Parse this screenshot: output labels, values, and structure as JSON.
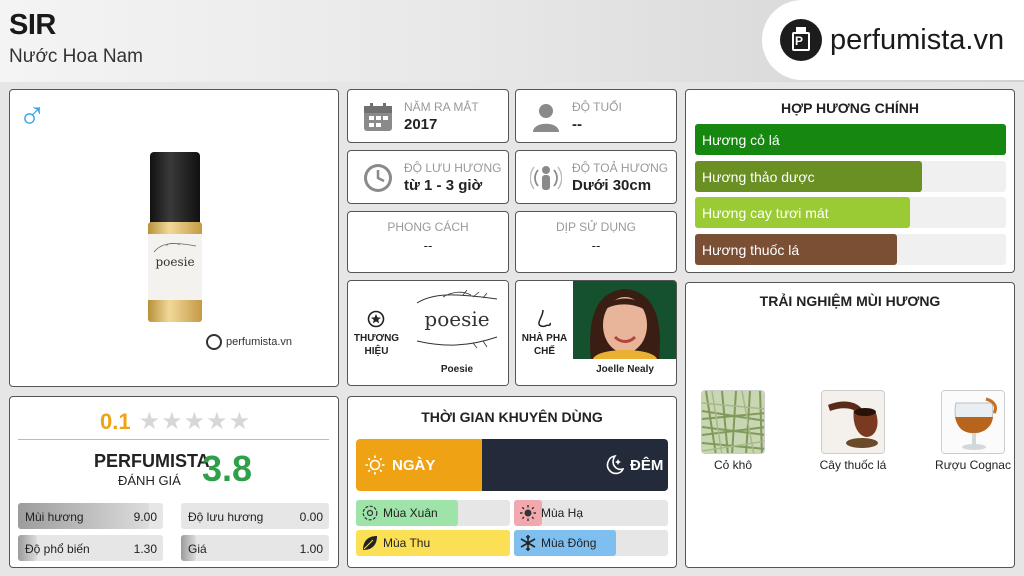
{
  "header": {
    "title": "SIR",
    "subtitle": "Nước Hoa Nam",
    "logo_text": "perfumista.vn"
  },
  "product": {
    "gender_symbol": "♂",
    "label_text": "poesie",
    "watermark": "perfumista.vn"
  },
  "rating": {
    "user_score": "0.1",
    "user_stars": 0,
    "perfumista_label": "PERFUMISTA",
    "perfumista_sub": "ĐÁNH GIÁ",
    "perfumista_score": "3.8",
    "stats": [
      {
        "label": "Mùi hương",
        "value": "9.00",
        "fraction": 0.9
      },
      {
        "label": "Độ lưu hương",
        "value": "0.00",
        "fraction": 0.0
      },
      {
        "label": "Độ phổ biến",
        "value": "1.30",
        "fraction": 0.13
      },
      {
        "label": "Giá",
        "value": "1.00",
        "fraction": 0.1
      }
    ]
  },
  "info": {
    "year": {
      "label": "NĂM RA MẮT",
      "value": "2017"
    },
    "age": {
      "label": "ĐỘ TUỔI",
      "value": "--"
    },
    "longevity": {
      "label": "ĐỘ LƯU HƯƠNG",
      "value": "từ 1 - 3 giờ"
    },
    "sillage": {
      "label": "ĐỘ TOẢ HƯƠNG",
      "value": "Dưới 30cm"
    },
    "style": {
      "label": "PHONG CÁCH",
      "value": "--"
    },
    "occasion": {
      "label": "DỊP SỬ DỤNG",
      "value": "--"
    },
    "brand": {
      "label": "THƯƠNG HIỆU",
      "logo_text": "poesie",
      "name": "Poesie"
    },
    "perfumer": {
      "label": "NHÀ PHA CHẾ",
      "name": "Joelle Nealy"
    }
  },
  "time": {
    "title": "THỜI GIAN KHUYÊN DÙNG",
    "day_label": "NGÀY",
    "night_label": "ĐÊM",
    "seasons": [
      {
        "label": "Mùa Xuân",
        "fraction": 0.66,
        "color": "#9ee3a8"
      },
      {
        "label": "Mùa Hạ",
        "fraction": 0.18,
        "color": "#f2a9ad"
      },
      {
        "label": "Mùa Thu",
        "fraction": 1.0,
        "color": "#fbdf55"
      },
      {
        "label": "Mùa Đông",
        "fraction": 0.66,
        "color": "#7fbfef"
      }
    ]
  },
  "accords": {
    "title": "HỢP HƯƠNG CHÍNH",
    "items": [
      {
        "label": "Hương cỏ lá",
        "fraction": 1.0,
        "color": "#16870f"
      },
      {
        "label": "Hương thảo dược",
        "fraction": 0.73,
        "color": "#6a8f23"
      },
      {
        "label": "Hương cay tươi mát",
        "fraction": 0.69,
        "color": "#9acb35"
      },
      {
        "label": "Hương thuốc lá",
        "fraction": 0.65,
        "color": "#7b4f33"
      }
    ]
  },
  "notes": {
    "title": "TRẢI NGHIỆM MÙI HƯƠNG",
    "items": [
      {
        "label": "Cỏ khô",
        "icon": "hay-image"
      },
      {
        "label": "Cây thuốc lá",
        "icon": "tobacco-pipe-image"
      },
      {
        "label": "Rượu Cognac",
        "icon": "cognac-glass-image"
      }
    ]
  }
}
